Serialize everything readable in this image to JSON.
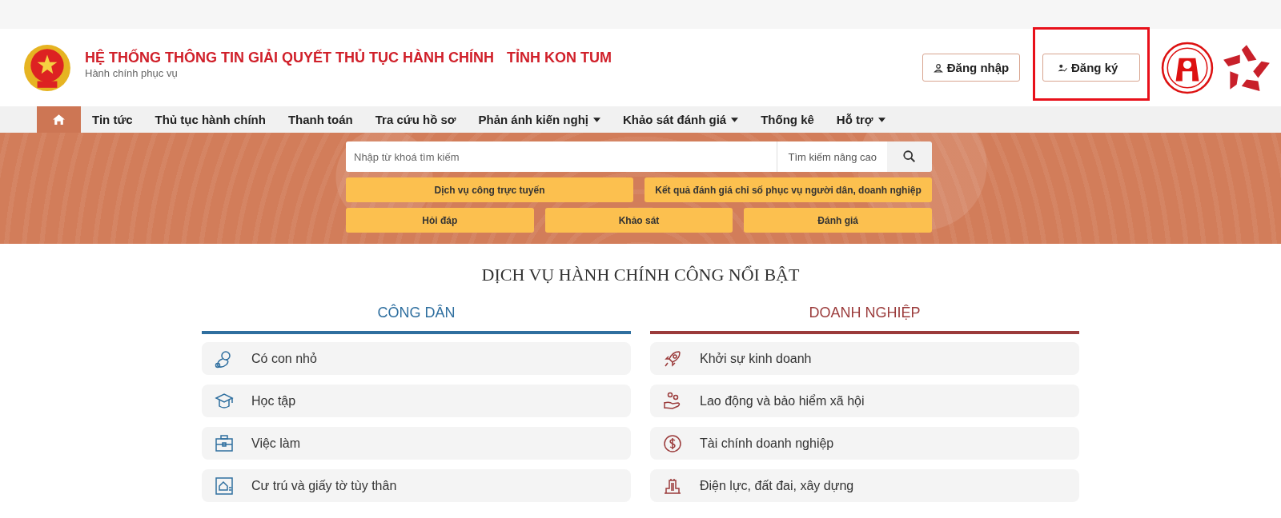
{
  "header": {
    "title": "HỆ THỐNG THÔNG TIN GIẢI QUYẾT THỦ TỤC HÀNH CHÍNH",
    "province": "TỈNH KON TUM",
    "subtitle": "Hành chính phục vụ",
    "auth_buttons": [
      {
        "kind": "login",
        "label": "Đăng nhập",
        "highlighted": false
      },
      {
        "kind": "register",
        "label": "Đăng ký",
        "highlighted": true
      }
    ]
  },
  "nav": [
    {
      "kind": "home",
      "selected": true
    },
    {
      "kind": "link",
      "label": "Tin tức",
      "selected": false,
      "dropdown": false
    },
    {
      "kind": "link",
      "label": "Thủ tục hành chính",
      "selected": false,
      "dropdown": false
    },
    {
      "kind": "link",
      "label": "Thanh toán",
      "selected": false,
      "dropdown": false
    },
    {
      "kind": "link",
      "label": "Tra cứu hồ sơ",
      "selected": false,
      "dropdown": false
    },
    {
      "kind": "link",
      "label": "Phản ánh kiến nghị",
      "selected": false,
      "dropdown": true
    },
    {
      "kind": "link",
      "label": "Khảo sát đánh giá",
      "selected": false,
      "dropdown": true
    },
    {
      "kind": "link",
      "label": "Thống kê",
      "selected": false,
      "dropdown": false
    },
    {
      "kind": "link",
      "label": "Hỗ trợ",
      "selected": false,
      "dropdown": true
    }
  ],
  "search": {
    "placeholder": "Nhập từ khoá tìm kiếm",
    "advanced": "Tìm kiếm nâng cao"
  },
  "quick_links": [
    [
      "Dịch vụ công trực tuyến",
      "Kết quả đánh giá chỉ số phục vụ người dân, doanh nghiệp"
    ],
    [
      "Hỏi đáp",
      "Khảo sát",
      "Đánh giá"
    ]
  ],
  "featured": {
    "title": "DỊCH VỤ HÀNH CHÍNH CÔNG NỔI BẬT",
    "columns": [
      {
        "heading": "CÔNG DÂN",
        "color": "#2f6f9f",
        "items": [
          "Có con nhỏ",
          "Học tập",
          "Việc làm",
          "Cư trú và giấy tờ tùy thân"
        ]
      },
      {
        "heading": "DOANH NGHIỆP",
        "color": "#9b3b3b",
        "items": [
          "Khởi sự kinh doanh",
          "Lao động và bảo hiểm xã hội",
          "Tài chính doanh nghiệp",
          "Điện lực, đất đai, xây dựng"
        ]
      }
    ]
  }
}
